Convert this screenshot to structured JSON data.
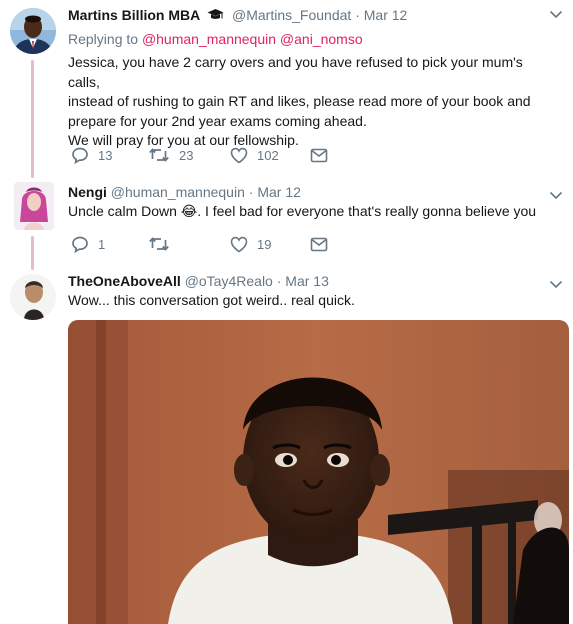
{
  "tweets": [
    {
      "name": "Martins Billion MBA",
      "handle": "@Martins_Foundat",
      "date": "Mar 12",
      "replying_label": "Replying to",
      "mentions": [
        "@human_mannequin",
        "@ani_nomso"
      ],
      "text_lines": [
        "Jessica, you have 2 carry overs and you have refused to pick your mum's calls,",
        "instead of rushing to gain RT and likes, please read more of your book and",
        "prepare for your 2nd year exams  coming ahead.",
        "We will pray for you at our fellowship."
      ],
      "replies": "13",
      "retweets": "23",
      "likes": "102"
    },
    {
      "name": "Nengi",
      "handle": "@human_mannequin",
      "date": "Mar 12",
      "text": "Uncle calm Down",
      "emoji": "😂",
      "text_after": ". I feel bad for everyone that's really gonna believe you",
      "replies": "1",
      "retweets": "",
      "likes": "19"
    },
    {
      "name": "TheOneAboveAll",
      "handle": "@oTay4Realo",
      "date": "Mar 13",
      "text": "Wow... this conversation got weird.. real quick."
    }
  ],
  "dot": "·",
  "icons": {
    "verified_cap": "graduation-cap-icon",
    "menu": "chevron-down-icon",
    "reply": "reply-icon",
    "retweet": "retweet-icon",
    "like": "heart-icon",
    "dm": "envelope-icon"
  },
  "colors": {
    "mention": "#e0245e",
    "secondary_text": "#657786",
    "thread_line": "#e1bcd0",
    "primary_text": "#14171a"
  }
}
